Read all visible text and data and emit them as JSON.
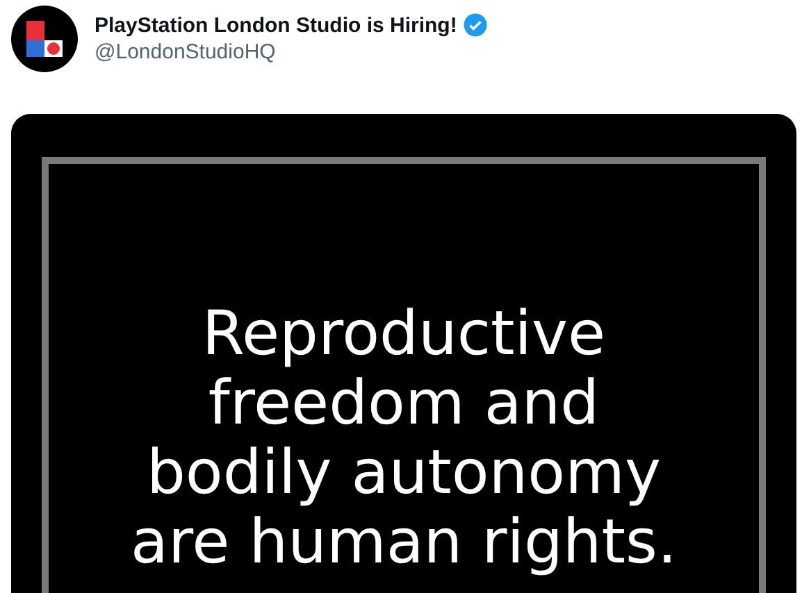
{
  "author": {
    "name": "PlayStation London Studio is Hiring!",
    "verified": true,
    "handle": "@LondonStudioHQ"
  },
  "media": {
    "lines": [
      "Reproductive",
      "freedom and",
      "bodily autonomy",
      "are human rights."
    ]
  }
}
